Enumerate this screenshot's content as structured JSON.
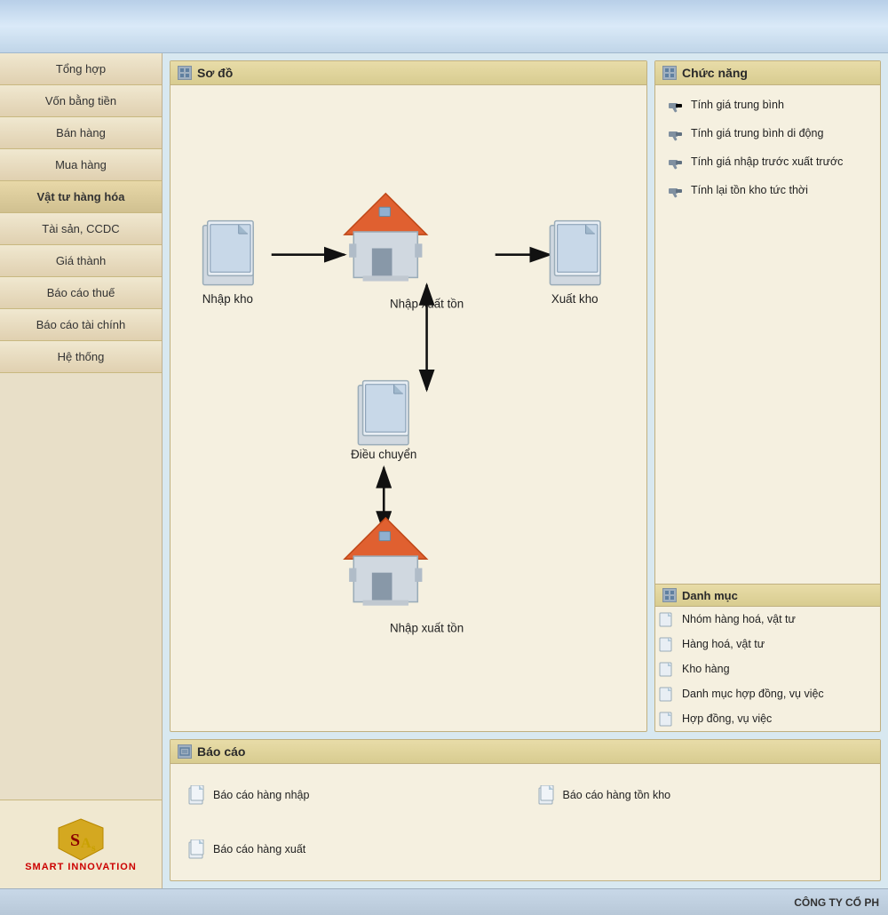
{
  "top_bar": {},
  "sidebar": {
    "items": [
      {
        "id": "tong-hop",
        "label": "Tổng hợp"
      },
      {
        "id": "von-bang-tien",
        "label": "Vốn bằng tiền"
      },
      {
        "id": "ban-hang",
        "label": "Bán hàng"
      },
      {
        "id": "mua-hang",
        "label": "Mua hàng"
      },
      {
        "id": "vat-tu-hang-hoa",
        "label": "Vật tư hàng hóa",
        "active": true
      },
      {
        "id": "tai-san-ccdc",
        "label": "Tài sản, CCDC"
      },
      {
        "id": "gia-thanh",
        "label": "Giá thành"
      },
      {
        "id": "bao-cao-thue",
        "label": "Báo cáo thuế"
      },
      {
        "id": "bao-cao-tai-chinh",
        "label": "Báo cáo tài chính"
      },
      {
        "id": "he-thong",
        "label": "Hệ thống"
      }
    ],
    "logo": {
      "brand": "SMART INNOVATION"
    }
  },
  "so_do": {
    "title": "Sơ đồ",
    "nodes": {
      "nhap_kho": "Nhập kho",
      "nhap_xuat_ton_top": "Nhập xuất tồn",
      "xuat_kho": "Xuất kho",
      "dieu_chuyen": "Điều chuyển",
      "nhap_xuat_ton_bot": "Nhập xuất tồn"
    }
  },
  "chuc_nang": {
    "title": "Chức năng",
    "items": [
      "Tính giá trung bình",
      "Tính giá trung bình di động",
      "Tính giá nhập trước xuất trước",
      "Tính lại tồn kho tức thời"
    ],
    "danh_muc": {
      "title": "Danh mục",
      "items": [
        "Nhóm hàng hoá, vật tư",
        "Hàng hoá, vật tư",
        "Kho hàng",
        "Danh mục hợp đồng, vụ việc",
        "Hợp đồng, vụ việc"
      ]
    }
  },
  "bao_cao": {
    "title": "Báo cáo",
    "items": [
      "Báo cáo hàng nhập",
      "Báo cáo hàng tồn kho",
      "Báo cáo hàng xuất"
    ]
  },
  "bottom_bar": {
    "company": "CÔNG TY CỔ PH"
  }
}
